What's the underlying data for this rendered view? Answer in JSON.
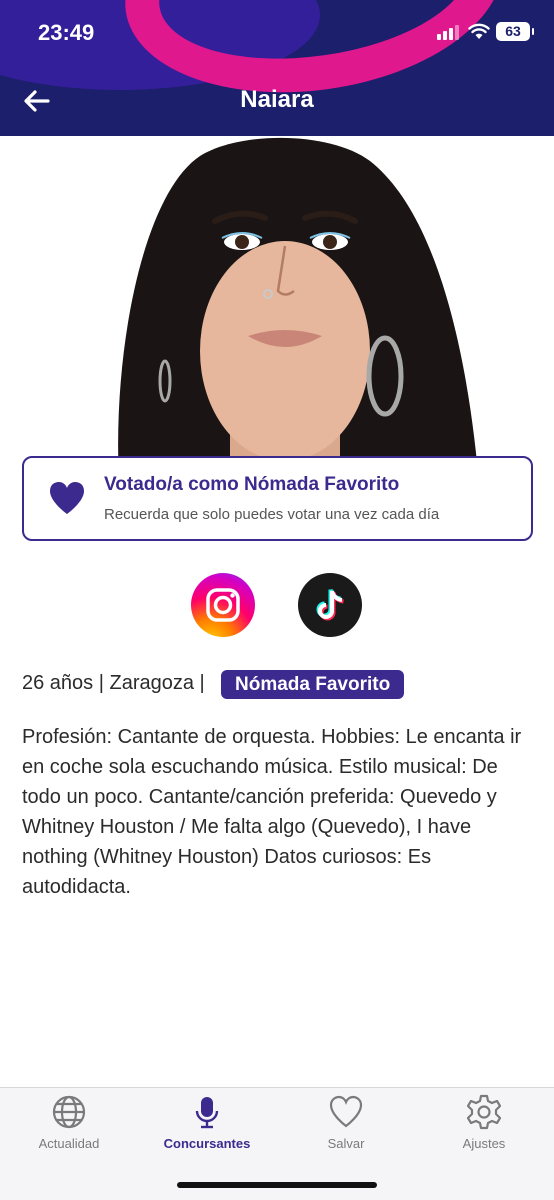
{
  "status_bar": {
    "time": "23:49",
    "battery": "63"
  },
  "nav": {
    "title": "Naiara"
  },
  "vote_card": {
    "title": "Votado/a como Nómada Favorito",
    "subtitle": "Recuerda que solo puedes votar una vez cada día"
  },
  "socials": [
    {
      "name": "instagram-icon"
    },
    {
      "name": "tiktok-icon"
    }
  ],
  "info": {
    "text": "26 años | Zaragoza |",
    "badge": "Nómada Favorito"
  },
  "bio": "Profesión: Cantante de orquesta.  Hobbies: Le encanta ir en coche sola escuchando música.  Estilo musical: De todo un poco.  Cantante/canción preferida: Quevedo y Whitney Houston / Me falta algo (Quevedo), I have nothing (Whitney Houston)  Datos curiosos: Es autodidacta.",
  "tabbar": {
    "tabs": [
      {
        "label": "Actualidad",
        "icon": "globe-icon",
        "active": false
      },
      {
        "label": "Concursantes",
        "icon": "microphone-icon",
        "active": true
      },
      {
        "label": "Salvar",
        "icon": "heart-icon",
        "active": false
      },
      {
        "label": "Ajustes",
        "icon": "gear-icon",
        "active": false
      }
    ]
  },
  "colors": {
    "accent": "#3c2a8f",
    "header_bg": "#1c1f6b",
    "header_swoosh": "#e0188d"
  }
}
